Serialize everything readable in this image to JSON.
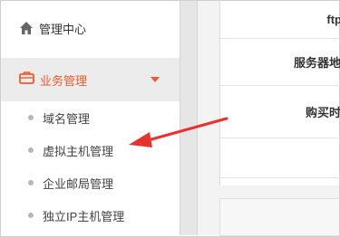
{
  "sidebar": {
    "home": {
      "label": "管理中心",
      "icon": "home-icon"
    },
    "business": {
      "label": "业务管理",
      "icon": "briefcase-icon",
      "expanded": true
    },
    "subitems": [
      {
        "label": "域名管理"
      },
      {
        "label": "虚拟主机管理"
      },
      {
        "label": "企业邮局管理"
      },
      {
        "label": "独立IP主机管理"
      }
    ]
  },
  "content": {
    "rows": [
      {
        "label": "ftp"
      },
      {
        "label": "服务器地"
      },
      {
        "label": "购买时"
      }
    ]
  },
  "colors": {
    "accent": "#f05a28",
    "arrow": "#e8322e"
  }
}
